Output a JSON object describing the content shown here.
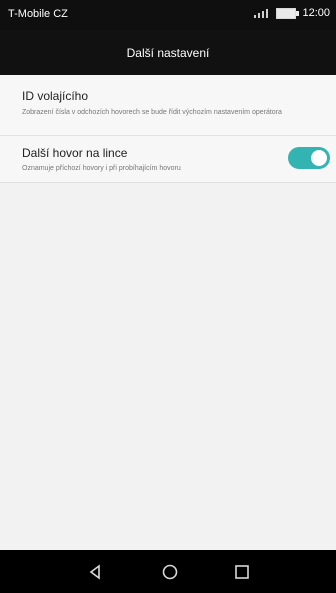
{
  "status_bar": {
    "carrier": "T-Mobile CZ",
    "time": "12:00",
    "signal_icon": "signal-icon",
    "battery_icon": "battery-icon"
  },
  "header": {
    "title": "Další nastavení"
  },
  "settings": {
    "items": [
      {
        "title": "ID volajícího",
        "description": "Zobrazení čísla v odchozích hovorech se bude řídit výchozím nastavením operátora"
      },
      {
        "title": "Další hovor na lince",
        "description": "Oznamuje příchozí hovory i při probíhajícím hovoru",
        "toggle": true
      }
    ]
  },
  "nav": {
    "back_icon": "back-icon",
    "home_icon": "home-icon",
    "recent_icon": "recent-apps-icon"
  },
  "colors": {
    "accent": "#34b3b3"
  }
}
